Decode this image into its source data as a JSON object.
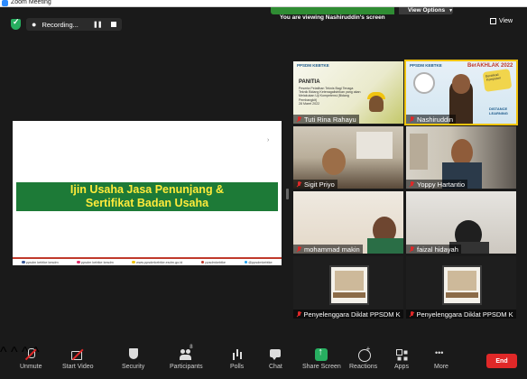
{
  "window": {
    "title": "Zoom Meeting"
  },
  "banner": {
    "text": "You are viewing Nashiruddin's screen",
    "view_options": "View Options"
  },
  "recording": {
    "label": "Recording..."
  },
  "view_button": {
    "label": "View"
  },
  "shared_screen": {
    "title_line1": "Ijin Usaha Jasa Penunjang &",
    "title_line2": "Sertifikat Badan Usaha",
    "footer_items": [
      "ppsdm kebtke kesdm",
      "ppsdm kebtke kesdm",
      "www.ppsdmkebtke.esdm.go.id",
      "ppsdmkebtke",
      "@ppsdmkebtke"
    ]
  },
  "participants": [
    {
      "name": "Tuti Rina Rahayu",
      "muted": true,
      "slide": {
        "logo": "PPSDM KEBTKE",
        "title": "PANITIA",
        "subtitle": "Peserta Pelatihan Teknis Bagi Tenaga Teknik Bidang Ketenagalistrikan yang akan Melakukan Uji Kompetensi (Bidang Pembangkit)",
        "date": "28 Maret 2022"
      }
    },
    {
      "name": "Nashiruddin",
      "muted": true,
      "slide": {
        "logo": "PPSDM KEBTKE",
        "tag": "BerAKHLAK 2022",
        "bubble": "Bertekad Kompeten",
        "footer": "DISTANCE LEARNING"
      }
    },
    {
      "name": "Sigit Priyo",
      "muted": true
    },
    {
      "name": "Yoppy Hartantio",
      "muted": true
    },
    {
      "name": "mohammad makin",
      "muted": true
    },
    {
      "name": "faizal hidayah",
      "muted": true
    },
    {
      "name": "Penyelenggara Diklat PPSDM KE...",
      "muted": true
    },
    {
      "name": "Penyelenggara Diklat PPSDM KE...",
      "muted": true
    }
  ],
  "toolbar": {
    "unmute": "Unmute",
    "start_video": "Start Video",
    "security": "Security",
    "participants": "Participants",
    "participants_count": "8",
    "polls": "Polls",
    "chat": "Chat",
    "share_screen": "Share Screen",
    "reactions": "Reactions",
    "apps": "Apps",
    "more": "More",
    "end": "End"
  }
}
